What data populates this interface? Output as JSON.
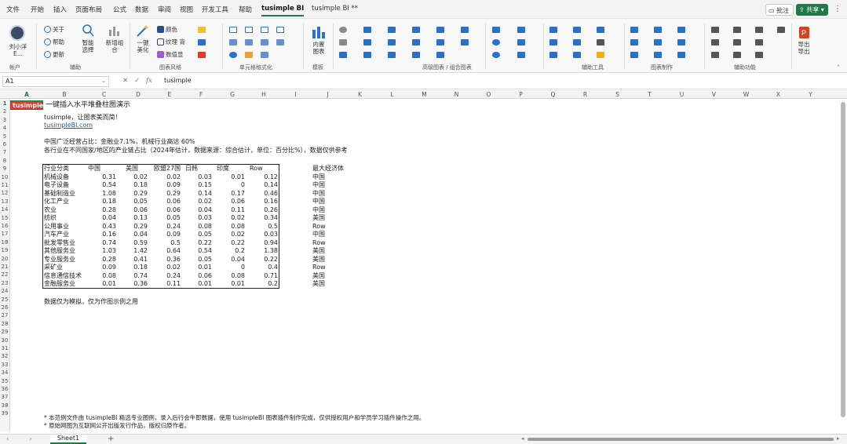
{
  "menu": {
    "items": [
      "文件",
      "开始",
      "插入",
      "页面布局",
      "公式",
      "数据",
      "审阅",
      "视图",
      "开发工具",
      "帮助",
      "tusimple BI",
      "tusimple BI **"
    ],
    "active_index": 10,
    "comment_label": "批注",
    "share_label": "共享"
  },
  "ribbon": {
    "user_name": "刘小洋 E...",
    "account_label": "帐户",
    "btn_about": "关于",
    "btn_help": "帮助",
    "btn_update": "更新",
    "btn_smart": "智能 选择",
    "btn_multi": "新增组 合",
    "group_assist": "辅助",
    "btn_onekey": "一键 美化",
    "btn_color": "颜色",
    "btn_texture": "纹理 背",
    "btn_number": "数值显",
    "group_chart": "图表风格",
    "group_single": "单元格格式化",
    "btn_builtin": "内置 图表",
    "group_builtin": "模板",
    "group_advanced": "高级图表 / 组合图表",
    "group_assist_tools": "辅助工具",
    "group_table_make": "图表制作",
    "group_help_fn": "辅助功能",
    "btn_export": "导出 导出"
  },
  "formula_bar": {
    "name_box": "A1",
    "value": "tusimple"
  },
  "grid": {
    "columns": [
      "A",
      "B",
      "C",
      "D",
      "E",
      "F",
      "G",
      "H",
      "I",
      "J",
      "K",
      "L",
      "M",
      "N",
      "O",
      "P",
      "Q",
      "R",
      "S",
      "T",
      "U",
      "V",
      "W",
      "X",
      "Y"
    ],
    "selected_column": "A",
    "rows": [
      "1",
      "2",
      "3",
      "4",
      "5",
      "6",
      "7",
      "8",
      "9",
      "10",
      "11",
      "12",
      "13",
      "14",
      "15",
      "16",
      "17",
      "18",
      "19",
      "20",
      "21",
      "22",
      "23",
      "24",
      "25",
      "26",
      "27",
      "28",
      "29",
      "30",
      "31",
      "32",
      "33",
      "34",
      "35",
      "36",
      "37",
      "38",
      "39"
    ],
    "a1_value": "tusimple",
    "b1_title": "一键插入水平堆叠柱图演示",
    "b2_text": "tusimple，让图表美而简！",
    "b3_link": "tusimpleBI.com",
    "b5_text": "中国广泛经营占比：金融业7.1%，机械行业高达 60%",
    "b6_text": "各行业在不同国家/地区的产业链占比（2024年估计，数据来源：综合估计，单位：百分比%），数据仅供参考",
    "table": {
      "headers": [
        "行业分类",
        "中国",
        "美国",
        "欧盟27国",
        "日韩",
        "印度",
        "Row"
      ],
      "extra_header": "最大经济体",
      "rows": [
        {
          "name": "机械设备",
          "values": [
            "0.31",
            "0.02",
            "0.02",
            "0.03",
            "0.01",
            "0.12"
          ],
          "top": "中国"
        },
        {
          "name": "电子设备",
          "values": [
            "0.54",
            "0.18",
            "0.09",
            "0.15",
            "0",
            "0.14"
          ],
          "top": "中国"
        },
        {
          "name": "基础制造业",
          "values": [
            "1.08",
            "0.29",
            "0.29",
            "0.14",
            "0.17",
            "0.46"
          ],
          "top": "中国"
        },
        {
          "name": "化工产业",
          "values": [
            "0.18",
            "0.05",
            "0.06",
            "0.02",
            "0.06",
            "0.16"
          ],
          "top": "中国"
        },
        {
          "name": "农业",
          "values": [
            "0.28",
            "0.06",
            "0.06",
            "0.04",
            "0.11",
            "0.26"
          ],
          "top": "中国"
        },
        {
          "name": "纺织",
          "values": [
            "0.04",
            "0.13",
            "0.05",
            "0.03",
            "0.02",
            "0.34"
          ],
          "top": "美国"
        },
        {
          "name": "公用事业",
          "values": [
            "0.43",
            "0.29",
            "0.24",
            "0.08",
            "0.08",
            "0.5"
          ],
          "top": "Row"
        },
        {
          "name": "汽车产业",
          "values": [
            "0.16",
            "0.04",
            "0.09",
            "0.05",
            "0.02",
            "0.03"
          ],
          "top": "中国"
        },
        {
          "name": "批发零售业",
          "values": [
            "0.74",
            "0.59",
            "0.5",
            "0.22",
            "0.22",
            "0.94"
          ],
          "top": "Row"
        },
        {
          "name": "其他服务业",
          "values": [
            "1.03",
            "1.42",
            "0.64",
            "0.54",
            "0.2",
            "1.38"
          ],
          "top": "美国"
        },
        {
          "name": "专业服务业",
          "values": [
            "0.28",
            "0.41",
            "0.36",
            "0.05",
            "0.04",
            "0.22"
          ],
          "top": "美国"
        },
        {
          "name": "采矿业",
          "values": [
            "0.09",
            "0.18",
            "0.02",
            "0.01",
            "0",
            "0.4"
          ],
          "top": "Row"
        },
        {
          "name": "信息通信技术",
          "values": [
            "0.08",
            "0.74",
            "0.24",
            "0.06",
            "0.08",
            "0.71"
          ],
          "top": "美国"
        },
        {
          "name": "金融服务业",
          "values": [
            "0.01",
            "0.36",
            "0.11",
            "0.01",
            "0.01",
            "0.2"
          ],
          "top": "美国"
        }
      ]
    },
    "b24_note": "数据仅为模拟，仅为作图示例之用",
    "b38_note": "* 本范例文件由 tusimpleBI 精选专业图例，录入后行会牛即数据，使用 tusimpleBI 图表插件制作完成，仅供授权用户和学员学习插件操作之用。",
    "b39_note": "* 原始网图为互联网公开出版发行作品，版权归原作者。"
  },
  "sheet_tabs": {
    "active": "Sheet1",
    "add_label": "+"
  },
  "colors": {
    "accent": "#1e7b45",
    "a1_fill": "#e23a2c"
  }
}
